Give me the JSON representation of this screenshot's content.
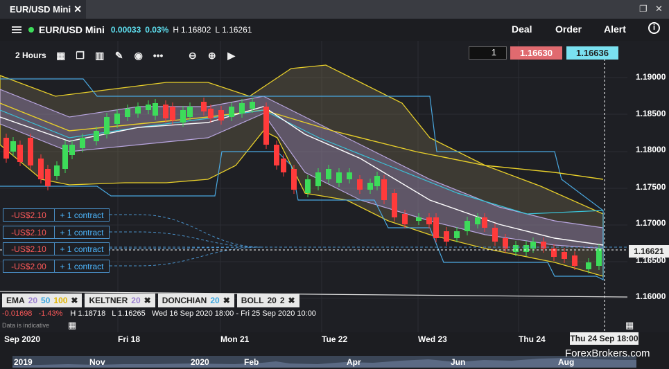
{
  "tab": {
    "title": "EUR/USD Mini"
  },
  "toolbar": {
    "symbol": "EUR/USD Mini",
    "change_abs": "0.00033",
    "change_pct": "0.03%",
    "high_label": "H",
    "high": "1.16802",
    "low_label": "L",
    "low": "1.16261",
    "deal": "Deal",
    "order": "Order",
    "alert": "Alert"
  },
  "timeframe": "2 Hours",
  "trade": {
    "quantity": "1",
    "sell": "1.16630",
    "buy": "1.16636"
  },
  "y_ticks": [
    "1.19000",
    "1.18500",
    "1.18000",
    "1.17500",
    "1.17000",
    "1.16500",
    "1.16000"
  ],
  "current_price": "1.16621",
  "orders": [
    {
      "amount": "-US$2.10",
      "contract": "+ 1 contract"
    },
    {
      "amount": "-US$2.10",
      "contract": "+ 1 contract"
    },
    {
      "amount": "-US$2.10",
      "contract": "+ 1 contract"
    },
    {
      "amount": "-US$2.00",
      "contract": "+ 1 contract"
    }
  ],
  "indicators": {
    "ema": {
      "name": "EMA",
      "p1": "20",
      "p2": "50",
      "p3": "100"
    },
    "keltner": {
      "name": "KELTNER",
      "p1": "20"
    },
    "donchian": {
      "name": "DONCHIAN",
      "p1": "20"
    },
    "boll": {
      "name": "BOLL",
      "p1": "20",
      "p2": "2"
    }
  },
  "info": {
    "change_abs": "-0.01698",
    "change_pct": "-1.43%",
    "high": "H 1.18718",
    "low": "L 1.16265",
    "range": "Wed 16 Sep 2020 18:00 - Fri 25 Sep 2020 10:00",
    "note": "Data is indicative"
  },
  "x_ticks": [
    "Sep 2020",
    "Fri 18",
    "Mon 21",
    "Tue 22",
    "Wed 23",
    "Thu 24"
  ],
  "date_tooltip": "Thu 24 Sep 18:00",
  "navigator": [
    "2019",
    "Nov",
    "2020",
    "Feb",
    "Apr",
    "Jun",
    "Aug"
  ],
  "brand": "ForexBrokers.com",
  "colors": {
    "up": "#3ddc5a",
    "down": "#ff3b3b",
    "sell": "#e06a6f",
    "buy": "#7ae1f0",
    "accent": "#5ee0f0"
  }
}
